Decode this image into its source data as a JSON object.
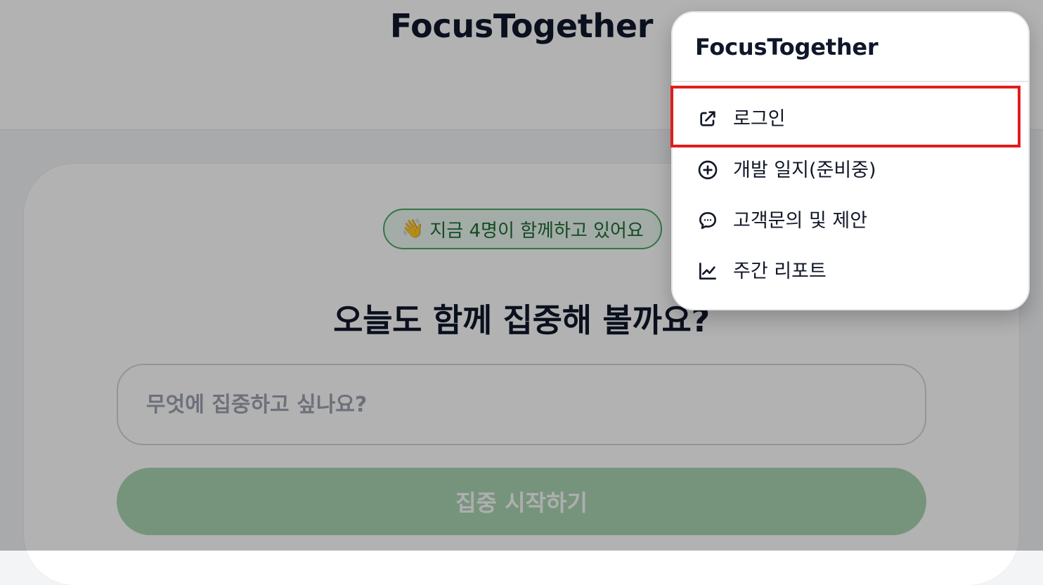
{
  "app": {
    "title": "FocusTogether"
  },
  "main": {
    "badge_emoji": "👋",
    "badge_text": "지금 4명이 함께하고 있어요",
    "headline": "오늘도 함께 집중해 볼까요?",
    "focus_input": {
      "placeholder": "무엇에 집중하고 싶나요?",
      "value": ""
    },
    "start_button_label": "집중 시작하기"
  },
  "menu": {
    "brand": "FocusTogether",
    "items": [
      {
        "label": "로그인",
        "icon": "external-link-icon"
      },
      {
        "label": "개발 일지(준비중)",
        "icon": "plus-circle-icon"
      },
      {
        "label": "고객문의 및 제안",
        "icon": "chat-bubble-icon"
      },
      {
        "label": "주간 리포트",
        "icon": "line-chart-icon"
      }
    ]
  },
  "colors": {
    "accent_green": "#4aa968",
    "button_green": "#a9d5b0",
    "highlight_red": "#e11d1d",
    "text_dark": "#0f172a"
  }
}
